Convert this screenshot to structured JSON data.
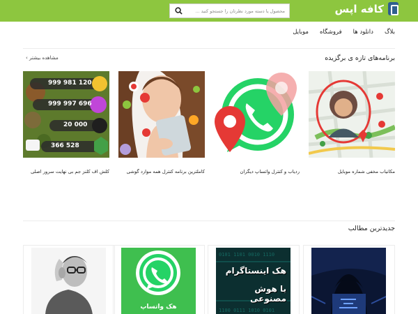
{
  "site": {
    "logo_text": "کافه اپس"
  },
  "search": {
    "placeholder": "محصول یا دسته مورد نظرتان را جستجو کنید ..."
  },
  "nav": {
    "items": [
      "موبایل",
      "فروشگاه",
      "دانلود ها",
      "بلاگ"
    ]
  },
  "featured": {
    "title": "برنامه‌های تازه ی برگزیده",
    "see_more": "مشاهده بیشتر ›",
    "items": [
      {
        "caption": "مکانیاب مخفی شماره موبایل"
      },
      {
        "caption": "ردیاب و کنترل واتساپ دیگران"
      },
      {
        "caption": "کاملترین برنامه کنترل همه موارد گوشی"
      },
      {
        "caption": "کلش اف کلنز جم بی نهایت سرور اصلی"
      }
    ],
    "game_stats": [
      "999 981 120",
      "999 997 696",
      "20 000",
      "366 528"
    ]
  },
  "latest": {
    "title": "جدیدترین مطالب",
    "whatsapp_label": "هک واتساپ",
    "instagram_label_1": "هک اینستاگرام",
    "instagram_label_2": "با هوش مصنوعی"
  },
  "colors": {
    "brand_green": "#8dc63f",
    "whatsapp_green": "#25d366",
    "pin_red": "#e53935"
  }
}
